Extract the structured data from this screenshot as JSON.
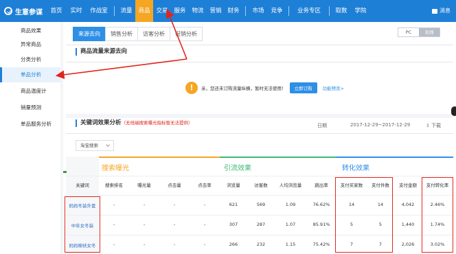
{
  "topbar": {
    "brand": "生意参谋",
    "nav": [
      "首页",
      "实时",
      "作战室",
      "流量",
      "商品",
      "交易",
      "服务",
      "物流",
      "营销",
      "财务",
      "市场",
      "竞争",
      "业务专区",
      "取数",
      "学院"
    ],
    "active": "商品",
    "message": "消息"
  },
  "sidebar": {
    "items": [
      "商品效果",
      "异常商品",
      "分类分析",
      "单品分析",
      "商品温度计",
      "销量预测",
      "单品服务分析"
    ],
    "active": "单品分析"
  },
  "tabs": [
    "来源去向",
    "销售分析",
    "访客分析",
    "促销分析"
  ],
  "active_tab": "来源去向",
  "device_toggle": {
    "pc": "PC",
    "wireless": "无线"
  },
  "source_section": {
    "title": "商品流量来源去向",
    "notice": "亲，您还未订购流量纵横，暂时无法使用！",
    "order_button": "立即订购",
    "preview_link": "功能预览>"
  },
  "keyword_section": {
    "title": "关键词效果分析",
    "note": "（无线端搜索曝光指标暂无法提供）",
    "date_label": "日期",
    "date_range": "2017-12-29~2017-12-29",
    "download": "下载",
    "filter": "淘宝搜索"
  },
  "table": {
    "groups": [
      {
        "label": "搜索曝光",
        "color": "#f5a623"
      },
      {
        "label": "引流效果",
        "color": "#3bb873"
      },
      {
        "label": "转化效果",
        "color": "#2d8fe6"
      }
    ],
    "headers": [
      "关键词",
      "搜索排名",
      "曝光量",
      "点击量",
      "点击率",
      "浏览量",
      "访客数",
      "人均浏览量",
      "跳出率",
      "支付买家数",
      "支付件数",
      "支付金额",
      "支付转化率"
    ],
    "rows": [
      [
        "妈妈冬装外套",
        "-",
        "-",
        "-",
        "-",
        "621",
        "569",
        "1.09",
        "76.62%",
        "14",
        "14",
        "4,042",
        "2.46%"
      ],
      [
        "中年女冬装",
        "-",
        "-",
        "-",
        "-",
        "307",
        "287",
        "1.07",
        "85.91%",
        "5",
        "5",
        "1,440",
        "1.74%"
      ],
      [
        "妈妈棉袄女冬",
        "-",
        "-",
        "-",
        "-",
        "266",
        "232",
        "1.15",
        "75.42%",
        "7",
        "7",
        "2,026",
        "3.02%"
      ]
    ]
  },
  "annotation_color": "#e0261b"
}
